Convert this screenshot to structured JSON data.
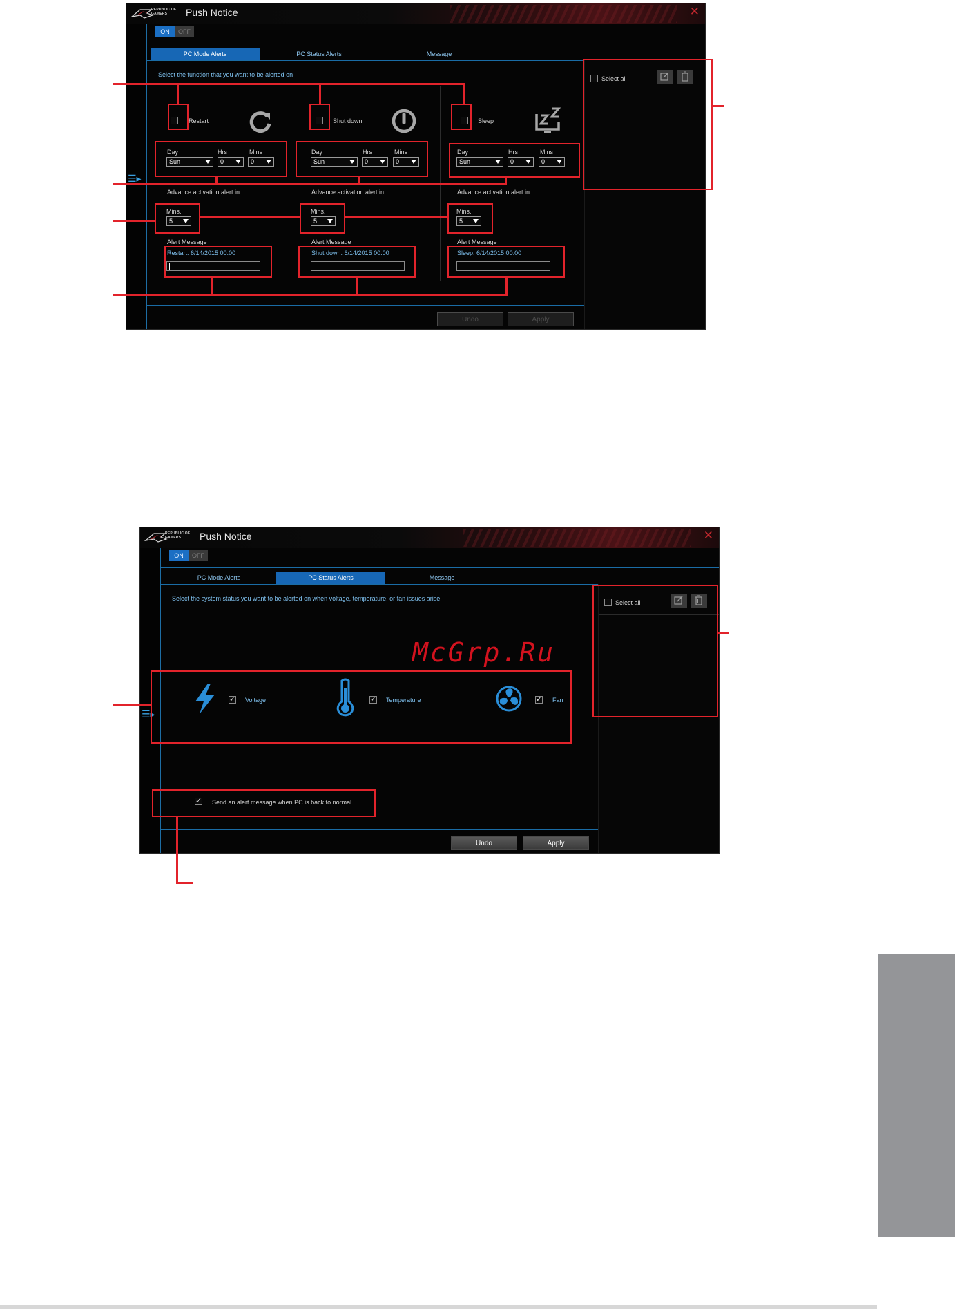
{
  "app": {
    "title": "Push Notice",
    "logo_line1": "REPUBLIC OF",
    "logo_line2": "GAMERS"
  },
  "toggle": {
    "on": "ON",
    "off": "OFF"
  },
  "tabs": [
    "PC Mode Alerts",
    "PC Status Alerts",
    "Message"
  ],
  "window1": {
    "hint": "Select the function that you want to be alerted on",
    "columns": [
      {
        "name": "Restart",
        "icon": "restart-icon",
        "day_label": "Day",
        "hrs_label": "Hrs",
        "mins_label": "Mins",
        "day": "Sun",
        "hrs": "0",
        "mins": "0",
        "advance_label": "Advance activation alert in :",
        "adv_mins_label": "Mins.",
        "adv_mins": "5",
        "alert_label": "Alert Message",
        "alert_default": "Restart: 6/14/2015 00:00"
      },
      {
        "name": "Shut down",
        "icon": "power-icon",
        "day_label": "Day",
        "hrs_label": "Hrs",
        "mins_label": "Mins",
        "day": "Sun",
        "hrs": "0",
        "mins": "0",
        "advance_label": "Advance activation alert in :",
        "adv_mins_label": "Mins.",
        "adv_mins": "5",
        "alert_label": "Alert Message",
        "alert_default": "Shut down: 6/14/2015 00:00"
      },
      {
        "name": "Sleep",
        "icon": "sleep-icon",
        "day_label": "Day",
        "hrs_label": "Hrs",
        "mins_label": "Mins",
        "day": "Sun",
        "hrs": "0",
        "mins": "0",
        "advance_label": "Advance activation alert in :",
        "adv_mins_label": "Mins.",
        "adv_mins": "5",
        "alert_label": "Alert Message",
        "alert_default": "Sleep: 6/14/2015 00:00"
      }
    ],
    "select_all": "Select all",
    "undo": "Undo",
    "apply": "Apply"
  },
  "window2": {
    "hint": "Select the system status you want to be alerted on when voltage, temperature, or fan issues arise",
    "items": [
      {
        "label": "Voltage",
        "icon": "lightning-icon",
        "checked": true
      },
      {
        "label": "Temperature",
        "icon": "thermometer-icon",
        "checked": true
      },
      {
        "label": "Fan",
        "icon": "fan-icon",
        "checked": true
      }
    ],
    "normal_message": "Send an alert message when PC is back to normal.",
    "select_all": "Select all",
    "undo": "Undo",
    "apply": "Apply"
  },
  "watermark": "McGrp.Ru",
  "colors": {
    "accent_blue": "#1767b5",
    "highlight_red": "#e2232b",
    "side_tab_gray": "#949598"
  }
}
